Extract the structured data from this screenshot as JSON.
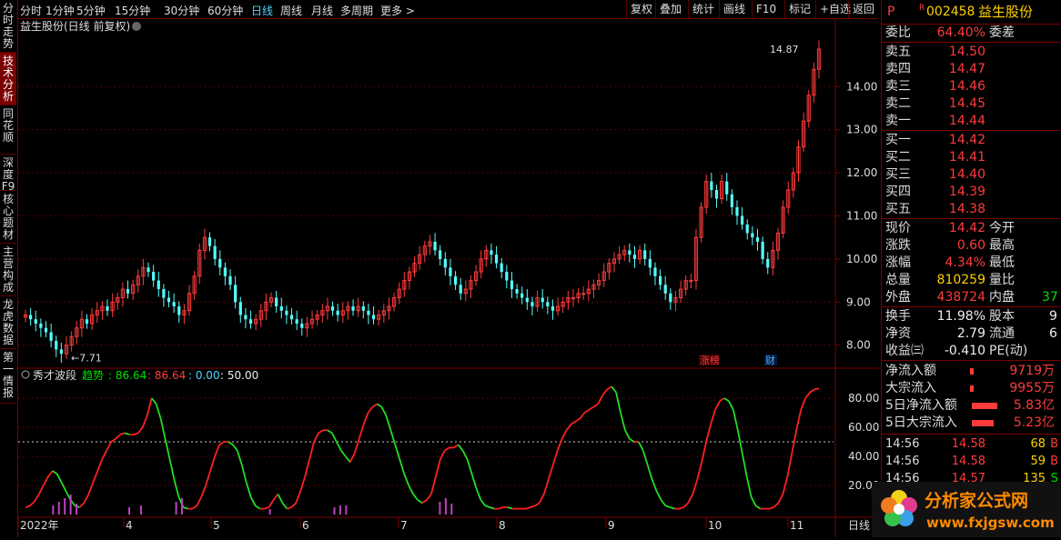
{
  "left_tabs": [
    {
      "label": "分时走势",
      "active": false
    },
    {
      "label": "技术分析",
      "active": true
    },
    {
      "label": "同花顺",
      "active": false
    },
    {
      "label": "深度F9",
      "active": false
    },
    {
      "label": "核心题材",
      "active": false
    },
    {
      "label": "主营构成",
      "active": false
    },
    {
      "label": "龙虎数据",
      "active": false
    },
    {
      "label": "第一情报",
      "active": false
    }
  ],
  "toolbar": {
    "periods": [
      "分时",
      "1分钟",
      "5分钟",
      "15分钟",
      "30分钟",
      "60分钟",
      "日线",
      "周线",
      "月线",
      "多周期",
      "更多 >"
    ],
    "active_period": "日线",
    "buttons": [
      "复权",
      "叠加",
      "统计",
      "画线",
      "F10",
      "标记",
      "+自选",
      "返回"
    ]
  },
  "main_chart": {
    "title": "益生股份(日线 前复权)",
    "high_label": "14.87",
    "low_label": "7.71",
    "y_ticks": [
      "14.00",
      "13.00",
      "12.00",
      "11.00",
      "10.00",
      "9.00",
      "8.00"
    ],
    "y_range": [
      7.55,
      15.25
    ],
    "markers": [
      {
        "label": "涨榜",
        "color": "#ff3b3b"
      },
      {
        "label": "财",
        "color": "#4fa9ff"
      }
    ]
  },
  "indicator": {
    "name": "秀才波段",
    "trend_label": "趋势",
    "trend_value": "86.64",
    "red_value": "86.64",
    "cyan_value": ": 0.00",
    "white_value": ": 50.00",
    "y_ticks": [
      "80.00",
      "60.00",
      "40.00",
      "20.00"
    ],
    "y_range": [
      0,
      100
    ]
  },
  "x_axis": {
    "labels": [
      "2022年",
      "4",
      "5",
      "6",
      "7",
      "8",
      "9",
      "10",
      "11"
    ],
    "right_label": "日线"
  },
  "chart_data": {
    "type": "candlestick",
    "title": "益生股份(日线 前复权)",
    "xlabel": "",
    "ylabel": "",
    "ylim": [
      7.55,
      15.25
    ],
    "close_series": [
      8.7,
      8.6,
      8.5,
      8.4,
      8.3,
      8.1,
      7.9,
      7.8,
      8.0,
      8.2,
      8.4,
      8.6,
      8.5,
      8.7,
      8.8,
      8.9,
      8.8,
      9.0,
      9.1,
      9.3,
      9.2,
      9.4,
      9.6,
      9.8,
      9.7,
      9.5,
      9.3,
      9.1,
      9.0,
      8.9,
      8.7,
      8.8,
      9.2,
      9.6,
      10.2,
      10.5,
      10.3,
      10.0,
      9.8,
      9.6,
      9.4,
      9.0,
      8.7,
      8.6,
      8.5,
      8.6,
      8.8,
      9.0,
      9.1,
      8.9,
      8.8,
      8.7,
      8.6,
      8.5,
      8.4,
      8.5,
      8.6,
      8.7,
      8.8,
      8.9,
      8.8,
      8.7,
      8.8,
      8.9,
      8.8,
      8.9,
      8.8,
      8.7,
      8.6,
      8.7,
      8.8,
      8.9,
      9.1,
      9.3,
      9.5,
      9.7,
      9.9,
      10.1,
      10.3,
      10.4,
      10.2,
      10.0,
      9.8,
      9.6,
      9.4,
      9.2,
      9.3,
      9.5,
      9.7,
      10.0,
      10.2,
      10.1,
      9.9,
      9.7,
      9.5,
      9.3,
      9.2,
      9.1,
      9.0,
      8.9,
      9.1,
      9.0,
      8.9,
      8.8,
      8.9,
      9.0,
      9.1,
      9.1,
      9.2,
      9.2,
      9.3,
      9.4,
      9.5,
      9.7,
      9.9,
      10.0,
      10.1,
      10.2,
      10.1,
      10.0,
      10.2,
      10.0,
      9.8,
      9.6,
      9.4,
      9.2,
      9.0,
      9.1,
      9.3,
      9.5,
      9.5,
      10.5,
      11.2,
      11.8,
      11.6,
      11.4,
      11.8,
      11.5,
      11.2,
      11.0,
      10.8,
      10.6,
      10.5,
      10.4,
      10.0,
      9.8,
      10.2,
      10.6,
      11.2,
      11.6,
      12.0,
      12.6,
      13.2,
      13.8,
      14.4,
      14.87
    ],
    "indicator_series": [
      {
        "name": "秀才波段",
        "values": [
          5,
          6,
          9,
          14,
          20,
          26,
          30,
          28,
          22,
          16,
          10,
          6,
          5,
          8,
          14,
          22,
          30,
          38,
          44,
          50,
          52,
          55,
          56,
          55,
          55,
          56,
          60,
          68,
          80,
          76,
          66,
          52,
          38,
          24,
          12,
          5,
          4,
          4,
          6,
          12,
          20,
          30,
          40,
          48,
          50,
          50,
          48,
          44,
          34,
          22,
          12,
          6,
          4,
          4,
          5,
          10,
          14,
          8,
          4,
          5,
          8,
          16,
          26,
          38,
          50,
          56,
          58,
          58,
          56,
          50,
          44,
          40,
          36,
          42,
          52,
          62,
          70,
          74,
          76,
          74,
          68,
          58,
          48,
          38,
          28,
          20,
          14,
          10,
          8,
          10,
          14,
          26,
          38,
          44,
          46,
          46,
          48,
          44,
          38,
          28,
          18,
          10,
          6,
          5,
          4,
          4,
          5,
          5,
          4,
          4,
          4,
          4,
          5,
          6,
          8,
          14,
          24,
          34,
          44,
          52,
          58,
          62,
          64,
          66,
          70,
          72,
          74,
          76,
          82,
          86,
          88,
          84,
          70,
          58,
          52,
          50,
          50,
          44,
          34,
          24,
          16,
          10,
          6,
          5,
          4,
          4,
          5,
          8,
          14,
          24,
          36,
          50,
          62,
          72,
          78,
          80,
          78,
          72,
          58,
          42,
          26,
          12,
          6,
          4,
          4,
          4,
          5,
          8,
          14,
          26,
          42,
          58,
          72,
          80,
          84,
          86,
          86.64
        ]
      }
    ]
  },
  "right_panel": {
    "quote": {
      "code": "002458",
      "name": "益生股份",
      "p_label": "P",
      "r_label": "R"
    },
    "webi": {
      "label": "委比",
      "value": "64.40%",
      "label2": "委差"
    },
    "sells": [
      {
        "label": "卖五",
        "price": "14.50"
      },
      {
        "label": "卖四",
        "price": "14.47"
      },
      {
        "label": "卖三",
        "price": "14.46"
      },
      {
        "label": "卖二",
        "price": "14.45"
      },
      {
        "label": "卖一",
        "price": "14.44"
      }
    ],
    "buys": [
      {
        "label": "买一",
        "price": "14.42"
      },
      {
        "label": "买二",
        "price": "14.41"
      },
      {
        "label": "买三",
        "price": "14.40"
      },
      {
        "label": "买四",
        "price": "14.39"
      },
      {
        "label": "买五",
        "price": "14.38"
      }
    ],
    "stats1": [
      {
        "label": "现价",
        "value": "14.42",
        "color": "red",
        "label2": "今开"
      },
      {
        "label": "涨跌",
        "value": "0.60",
        "color": "red",
        "label2": "最高"
      },
      {
        "label": "涨幅",
        "value": "4.34%",
        "color": "red",
        "label2": "最低"
      },
      {
        "label": "总量",
        "value": "810259",
        "color": "yellow",
        "label2": "量比"
      },
      {
        "label": "外盘",
        "value": "438724",
        "color": "red",
        "label2": "内盘",
        "extra": "37"
      }
    ],
    "stats2": [
      {
        "label": "换手",
        "value": "11.98%",
        "label2": "股本",
        "extra": "9"
      },
      {
        "label": "净资",
        "value": "2.79",
        "label2": "流通",
        "extra": "6"
      },
      {
        "label": "收益㈢",
        "value": "-0.410",
        "label2": "PE(动)"
      }
    ],
    "flows": [
      {
        "label": "净流入额",
        "value": "9719万",
        "bar": 4
      },
      {
        "label": "大宗流入",
        "value": "9955万",
        "bar": 4
      },
      {
        "label": "5日净流入额",
        "value": "5.83亿",
        "bar": 28
      },
      {
        "label": "5日大宗流入",
        "value": "5.23亿",
        "bar": 24
      }
    ],
    "ticks": [
      {
        "time": "14:56",
        "price": "14.58",
        "vol": "68",
        "bs": "B"
      },
      {
        "time": "14:56",
        "price": "14.58",
        "vol": "59",
        "bs": "B"
      },
      {
        "time": "14:56",
        "price": "14.57",
        "vol": "135",
        "bs": "S"
      }
    ]
  }
}
